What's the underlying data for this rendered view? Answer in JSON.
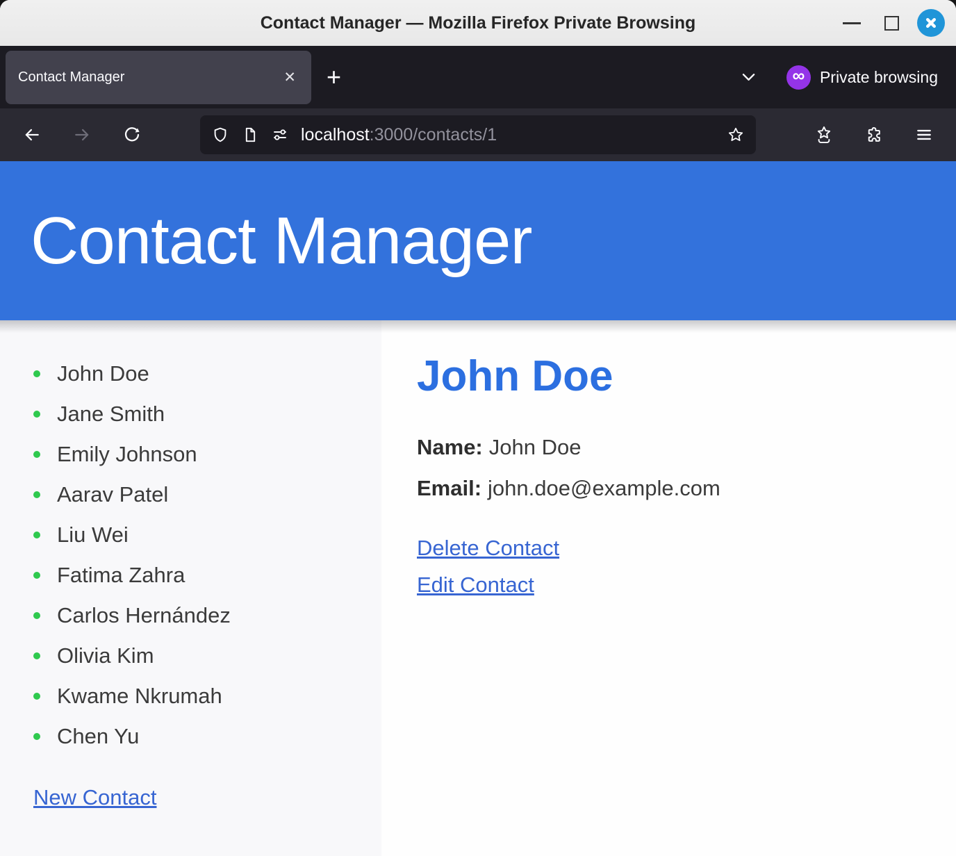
{
  "window": {
    "title": "Contact Manager — Mozilla Firefox Private Browsing"
  },
  "tabbar": {
    "tab_title": "Contact Manager",
    "close_tab_glyph": "✕",
    "new_tab_glyph": "+",
    "private_mask_glyph": "∞",
    "private_label": "Private browsing"
  },
  "navbar": {
    "url_host": "localhost",
    "url_path": ":3000/contacts/1"
  },
  "app_header": {
    "title": "Contact Manager"
  },
  "sidebar": {
    "contacts": [
      "John Doe",
      "Jane Smith",
      "Emily Johnson",
      "Aarav Patel",
      "Liu Wei",
      "Fatima Zahra",
      "Carlos Hernández",
      "Olivia Kim",
      "Kwame Nkrumah",
      "Chen Yu"
    ],
    "new_contact_label": "New Contact"
  },
  "detail": {
    "heading": "John Doe",
    "name_label": "Name:",
    "name_value": "John Doe",
    "email_label": "Email:",
    "email_value": "john.doe@example.com",
    "delete_label": "Delete Contact",
    "edit_label": "Edit Contact"
  },
  "colors": {
    "header_blue": "#3372dc",
    "heading_blue": "#2c6fe0",
    "link_blue": "#3765d2",
    "bullet_green": "#2fc94e",
    "private_purple": "#9434e8",
    "close_button_blue": "#2095d8",
    "toolbar_dark": "#2b2a33",
    "tabbar_dark": "#1c1b22"
  }
}
